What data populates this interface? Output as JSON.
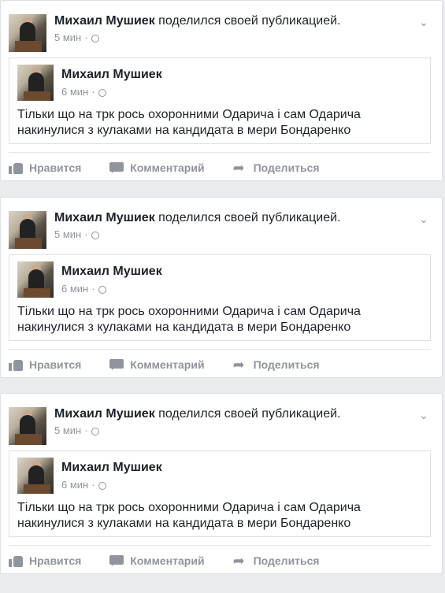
{
  "posts": [
    {
      "author": "Михаил Мушиек",
      "action": "поделился своей публикацией.",
      "time": "5 мин",
      "sep": "·",
      "shared": {
        "author": "Михаил Мушиек",
        "time": "6 мин",
        "sep": "·",
        "text_line1": "Тільки що на трк рось охоронними Одарича  і сам Одарича",
        "text_line2": "накинулися з кулаками на кандидата в мери Бондаренко"
      },
      "actions": {
        "like": "Нравится",
        "comment": "Комментарий",
        "share": "Поделиться"
      }
    },
    {
      "author": "Михаил Мушиек",
      "action": "поделился своей публикацией.",
      "time": "5 мин",
      "sep": "·",
      "shared": {
        "author": "Михаил Мушиек",
        "time": "6 мин",
        "sep": "·",
        "text_line1": "Тільки що на трк рось охоронними Одарича  і сам Одарича",
        "text_line2": "накинулися з кулаками на кандидата в мери Бондаренко"
      },
      "actions": {
        "like": "Нравится",
        "comment": "Комментарий",
        "share": "Поделиться"
      }
    },
    {
      "author": "Михаил Мушиек",
      "action": "поделился своей публикацией.",
      "time": "5 мин",
      "sep": "·",
      "shared": {
        "author": "Михаил Мушиек",
        "time": "6 мин",
        "sep": "·",
        "text_line1": "Тільки що на трк рось охоронними Одарича  і сам Одарича",
        "text_line2": "накинулися з кулаками на кандидата в мери Бондаренко"
      },
      "actions": {
        "like": "Нравится",
        "comment": "Комментарий",
        "share": "Поделиться"
      }
    }
  ],
  "icons": {
    "privacy": "globe-icon",
    "options": "chevron-down-icon",
    "like": "thumbs-up-icon",
    "comment": "comment-icon",
    "share": "share-arrow-icon"
  },
  "colors": {
    "background": "#e9ebee",
    "muted": "#90949c",
    "text": "#1d2129"
  }
}
